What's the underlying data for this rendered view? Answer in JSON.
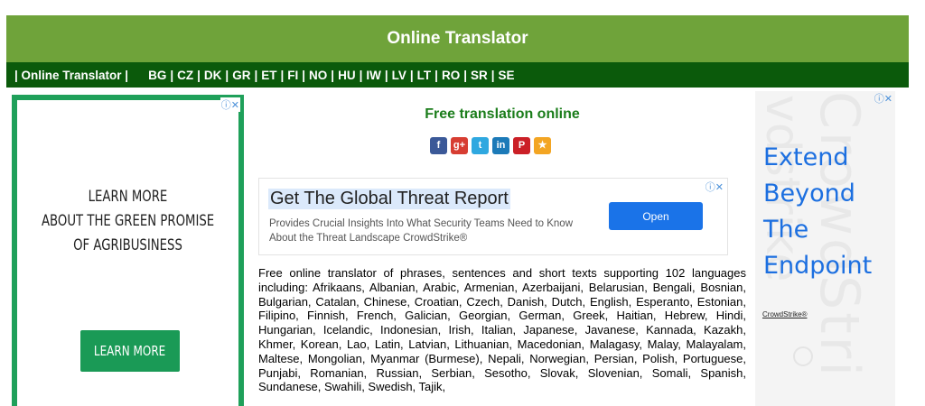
{
  "header": {
    "title": "Online Translator"
  },
  "navbar": {
    "brand": "| Online Translator |",
    "languages": [
      "BG",
      "CZ",
      "DK",
      "GR",
      "ET",
      "FI",
      "NO",
      "HU",
      "IW",
      "LV",
      "LT",
      "RO",
      "SR",
      "SE"
    ]
  },
  "left_ad": {
    "adchoices": "ⓘ✕",
    "lines": [
      "LEARN MORE",
      "ABOUT THE GREEN PROMISE",
      "OF AGRIBUSINESS"
    ],
    "button": "LEARN MORE"
  },
  "main": {
    "title": "Free translation online",
    "share_icons": [
      {
        "name": "facebook-icon",
        "glyph": "f",
        "color": "#3b5998"
      },
      {
        "name": "google-plus-icon",
        "glyph": "g+",
        "color": "#d73d32"
      },
      {
        "name": "twitter-icon",
        "glyph": "t",
        "color": "#2fa8e0"
      },
      {
        "name": "linkedin-icon",
        "glyph": "in",
        "color": "#1c7ab8"
      },
      {
        "name": "pinterest-icon",
        "glyph": "P",
        "color": "#cb2027"
      },
      {
        "name": "bookmark-star-icon",
        "glyph": "★",
        "color": "#f3a523"
      }
    ],
    "ad": {
      "adchoices": "ⓘ✕",
      "headline": "Get The Global Threat Report",
      "description": "Provides Crucial Insights Into What Security Teams Need to Know About the Threat Landscape CrowdStrike®",
      "button": "Open"
    },
    "body_text": "Free online translator of phrases, sentences and short texts supporting 102 languages including: Afrikaans, Albanian, Arabic, Armenian, Azerbaijani, Belarusian, Bengali, Bosnian, Bulgarian, Catalan, Chinese, Croatian, Czech, Danish, Dutch, English, Esperanto, Estonian, Filipino, Finnish, French, Galician, Georgian, German, Greek, Haitian, Hebrew, Hindi, Hungarian, Icelandic, Indonesian, Irish, Italian, Japanese, Javanese, Kannada, Kazakh, Khmer, Korean, Lao, Latin, Latvian, Lithuanian, Macedonian, Malagasy, Malay, Malayalam, Maltese, Mongolian, Myanmar (Burmese), Nepali, Norwegian, Persian, Polish, Portuguese, Punjabi, Romanian, Russian, Serbian, Sesotho, Slovak, Slovenian, Somali, Spanish, Sundanese, Swahili, Swedish, Tajik,"
  },
  "right_ad": {
    "adchoices": "ⓘ✕",
    "headline_lines": [
      "Extend",
      "Beyond",
      "The",
      "Endpoint"
    ],
    "brand": "CrowdStrike®",
    "watermark_1": "vdstrike",
    "watermark_2": "CrowdStri"
  }
}
